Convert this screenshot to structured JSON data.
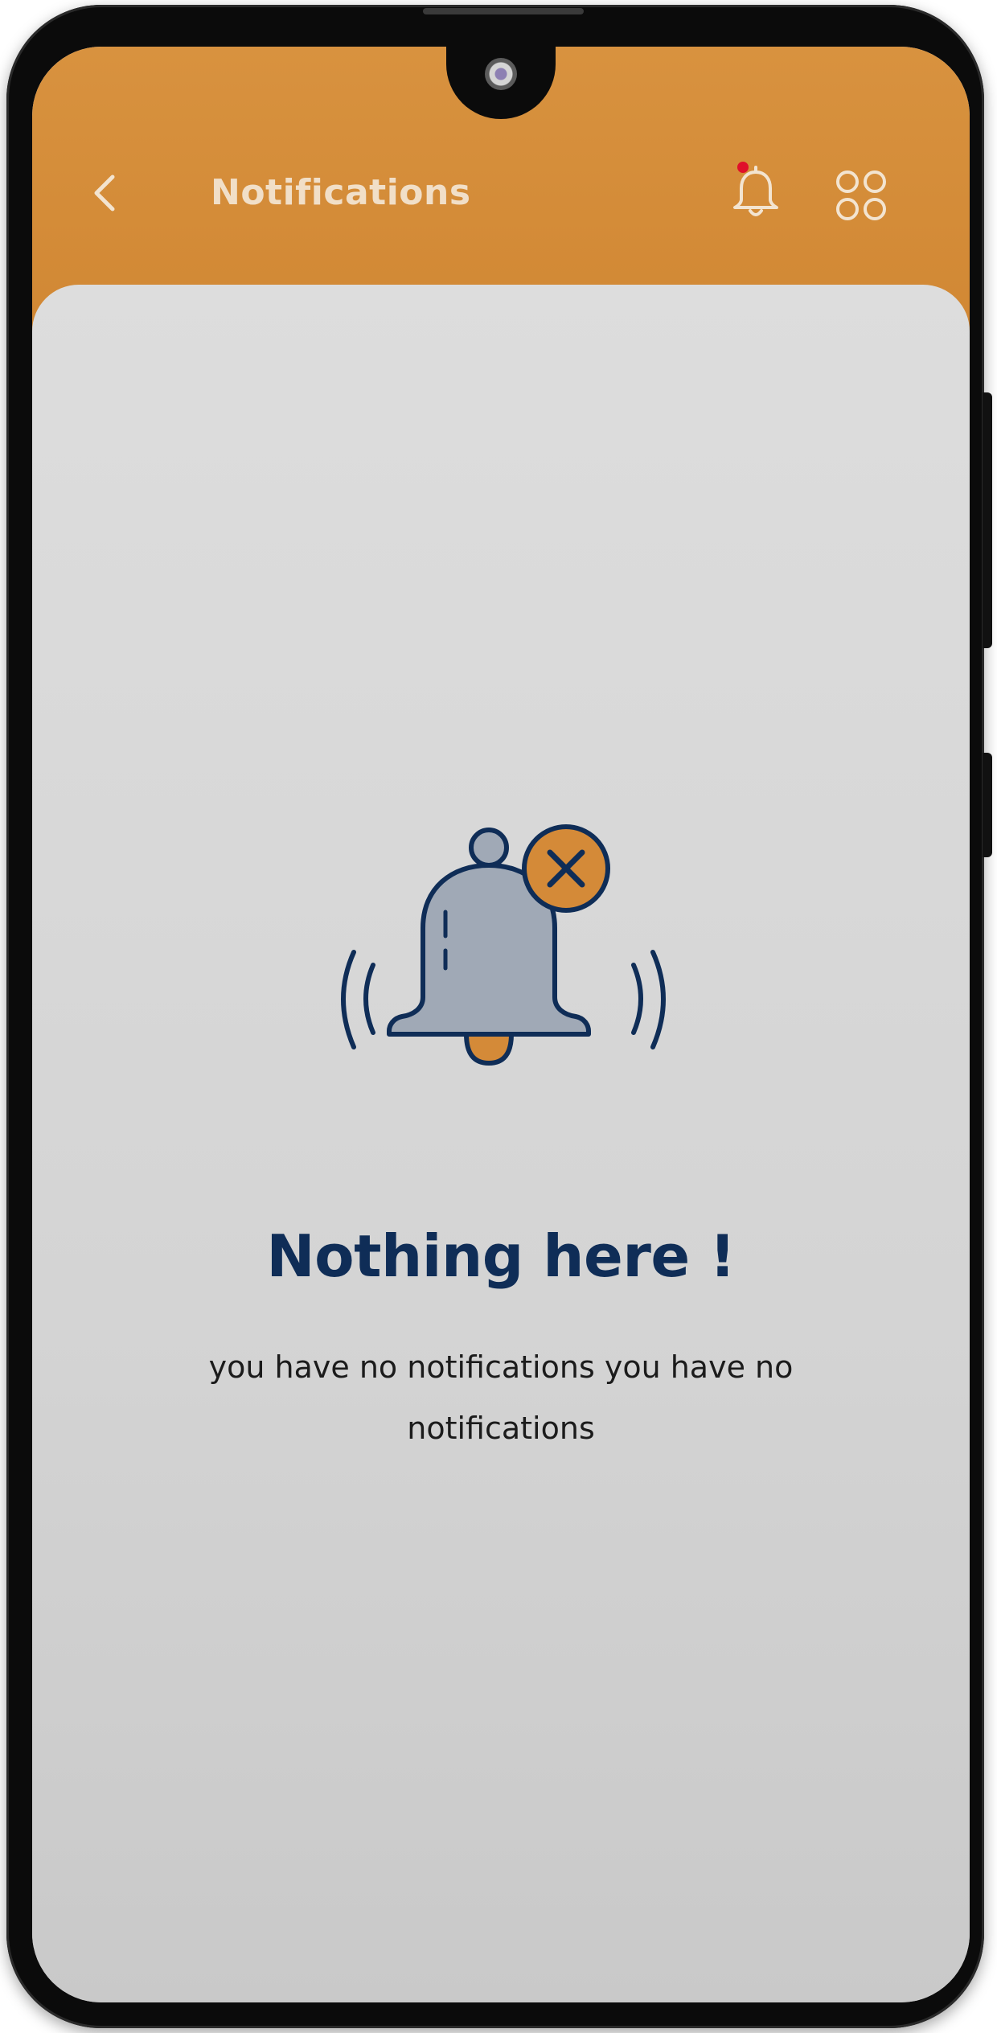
{
  "header": {
    "title": "Notifications",
    "back_icon": "chevron-left-icon",
    "bell_icon": "bell-icon",
    "grid_icon": "grid-circles-icon",
    "has_unread_dot": true
  },
  "empty_state": {
    "title": "Nothing here !",
    "message": "you have no notifications you have no notifications",
    "illustration_icon": "bell-off-icon"
  },
  "colors": {
    "accent": "#d48a38",
    "title_text": "#0f2d57",
    "unread_dot": "#e0102a",
    "bell_fill": "#a0a9b6"
  }
}
